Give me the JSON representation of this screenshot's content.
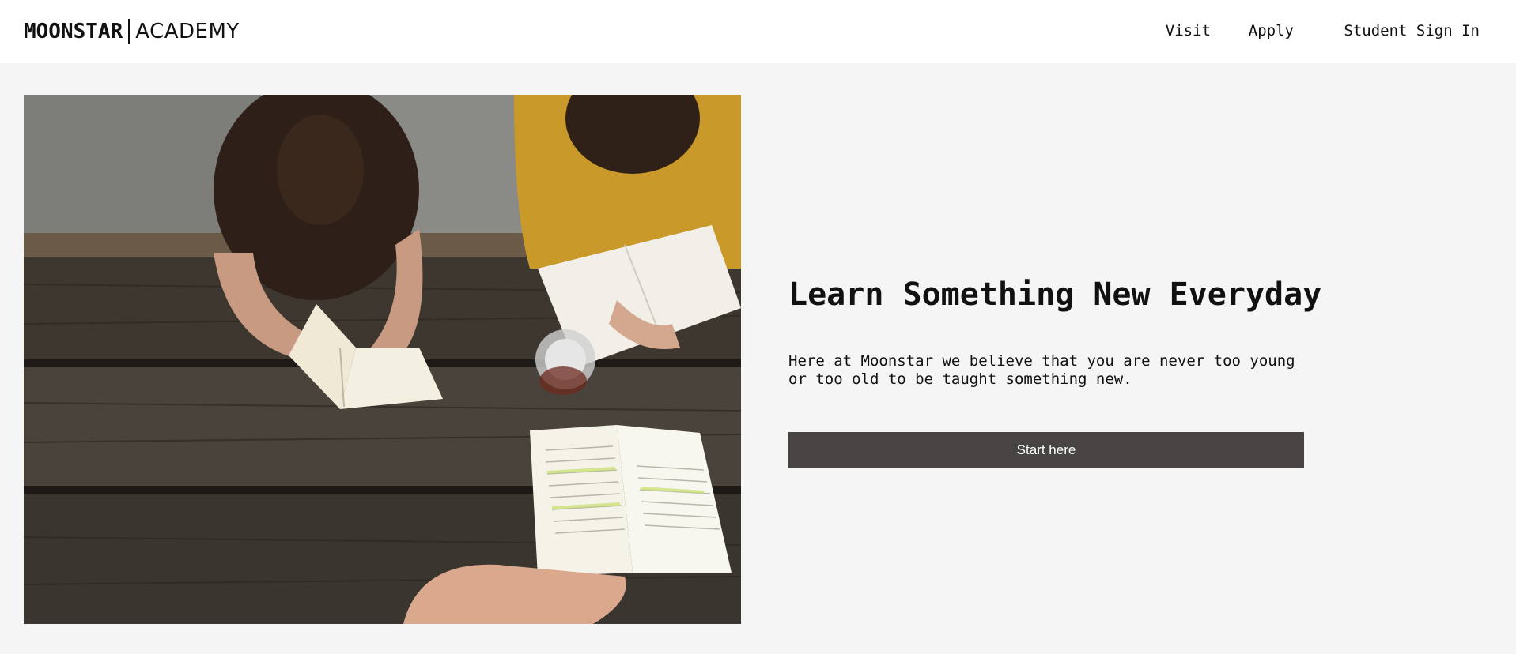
{
  "header": {
    "logo_bold": "MOONSTAR",
    "logo_light": "ACADEMY",
    "nav": {
      "visit": "Visit",
      "apply": "Apply",
      "sign_in": "Student Sign In"
    }
  },
  "hero": {
    "image_icon": "students-studying-photo",
    "title": "Learn Something New Everyday",
    "description": "Here at Moonstar we believe that you are never too young or too old to be taught something new.",
    "cta_label": "Start here"
  },
  "colors": {
    "page_background": "#f5f5f5",
    "header_background": "#ffffff",
    "button_background": "#474443",
    "button_text": "#ffffff",
    "text": "#111111"
  }
}
